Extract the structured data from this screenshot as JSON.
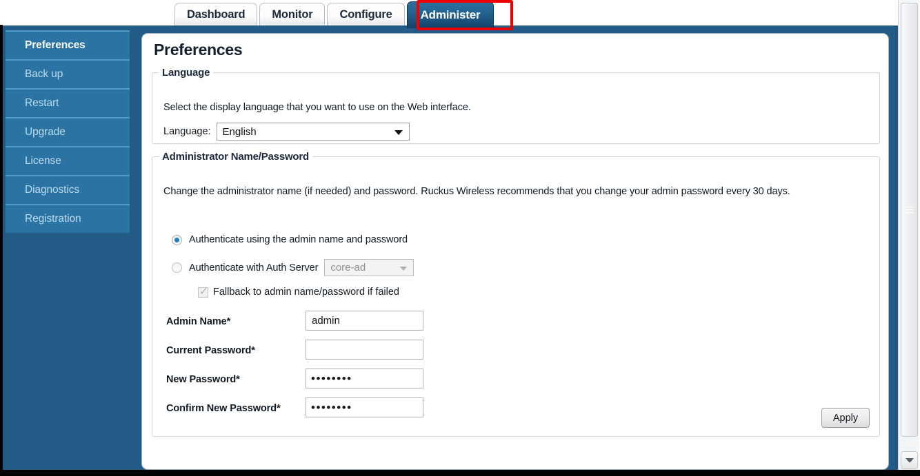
{
  "tabs": [
    {
      "label": "Dashboard",
      "active": false
    },
    {
      "label": "Monitor",
      "active": false
    },
    {
      "label": "Configure",
      "active": false
    },
    {
      "label": "Administer",
      "active": true
    }
  ],
  "sidebar": {
    "items": [
      {
        "label": "Preferences",
        "active": true
      },
      {
        "label": "Back up",
        "active": false
      },
      {
        "label": "Restart",
        "active": false
      },
      {
        "label": "Upgrade",
        "active": false
      },
      {
        "label": "License",
        "active": false
      },
      {
        "label": "Diagnostics",
        "active": false
      },
      {
        "label": "Registration",
        "active": false
      }
    ]
  },
  "page": {
    "title": "Preferences"
  },
  "language_section": {
    "legend": "Language",
    "description": "Select the display language that you want to use on the Web interface.",
    "field_label": "Language:",
    "selected": "English",
    "options": [
      "English"
    ]
  },
  "admin_section": {
    "legend": "Administrator Name/Password",
    "description": "Change the administrator name (if needed) and password. Ruckus Wireless recommends that you change your admin password every 30 days.",
    "radio_local_label": "Authenticate using the admin name and password",
    "radio_local_selected": true,
    "radio_server_label": "Authenticate with Auth Server",
    "radio_server_selected": false,
    "auth_server_selected": "core-ad",
    "auth_server_disabled": true,
    "fallback_label": "Fallback to admin name/password if failed",
    "fallback_checked": true,
    "fallback_disabled": true,
    "fields": [
      {
        "label": "Admin Name*",
        "value": "admin",
        "masked": false,
        "placeholder": ""
      },
      {
        "label": "Current Password*",
        "value": "",
        "masked": true,
        "placeholder": ""
      },
      {
        "label": "New Password*",
        "value": "••••••••",
        "masked": true,
        "placeholder": ""
      },
      {
        "label": "Confirm New Password*",
        "value": "••••••••",
        "masked": true,
        "placeholder": ""
      }
    ],
    "apply_label": "Apply"
  },
  "scrollbar": {
    "down_arrow": "▼"
  },
  "colors": {
    "nav_background": "#2a73a3",
    "body_background": "#215b86",
    "active_tab": "#23628f",
    "highlight": "#ee0000",
    "radio_dot": "#1f7fc0"
  }
}
